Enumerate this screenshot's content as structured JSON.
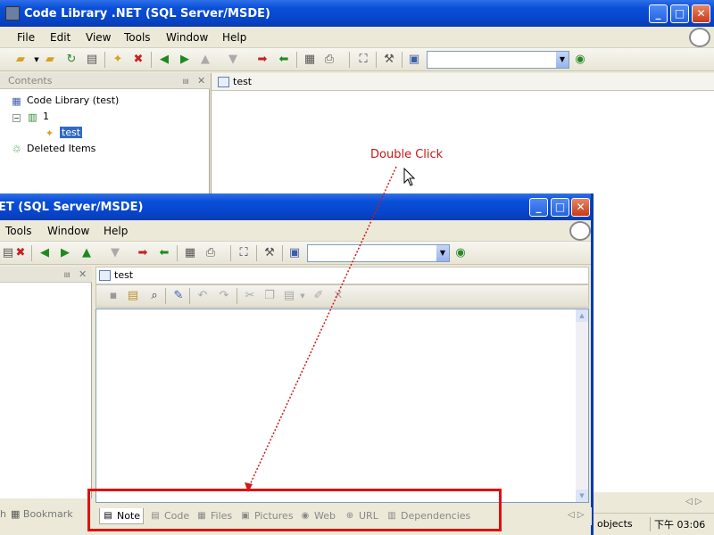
{
  "main_window": {
    "title": "Code Library .NET (SQL Server/MSDE)",
    "menu": [
      "File",
      "Edit",
      "View",
      "Tools",
      "Window",
      "Help"
    ],
    "contents_panel": {
      "title": "Contents",
      "pin": "⩏",
      "close": "✕",
      "tree": {
        "root": "Code Library (test)",
        "folder": "1",
        "item": "test",
        "deleted": "Deleted Items"
      }
    },
    "doc_tab": "test",
    "status": {
      "objects": "objects",
      "time": "下午 03:06"
    }
  },
  "annotation": "Double Click",
  "second_window": {
    "title": "ET (SQL Server/MSDE)",
    "menu": [
      "Tools",
      "Window",
      "Help"
    ],
    "doc_tab": "test",
    "bottom_tabs": [
      "Note",
      "Code",
      "Files",
      "Pictures",
      "Web",
      "URL",
      "Dependencies"
    ],
    "left_tabs": {
      "h": "h",
      "bookmark": "Bookmark"
    }
  },
  "colors": {
    "title_blue": "#0a4fd8",
    "annotation_red": "#c81818",
    "highlight_red": "#e01010"
  }
}
